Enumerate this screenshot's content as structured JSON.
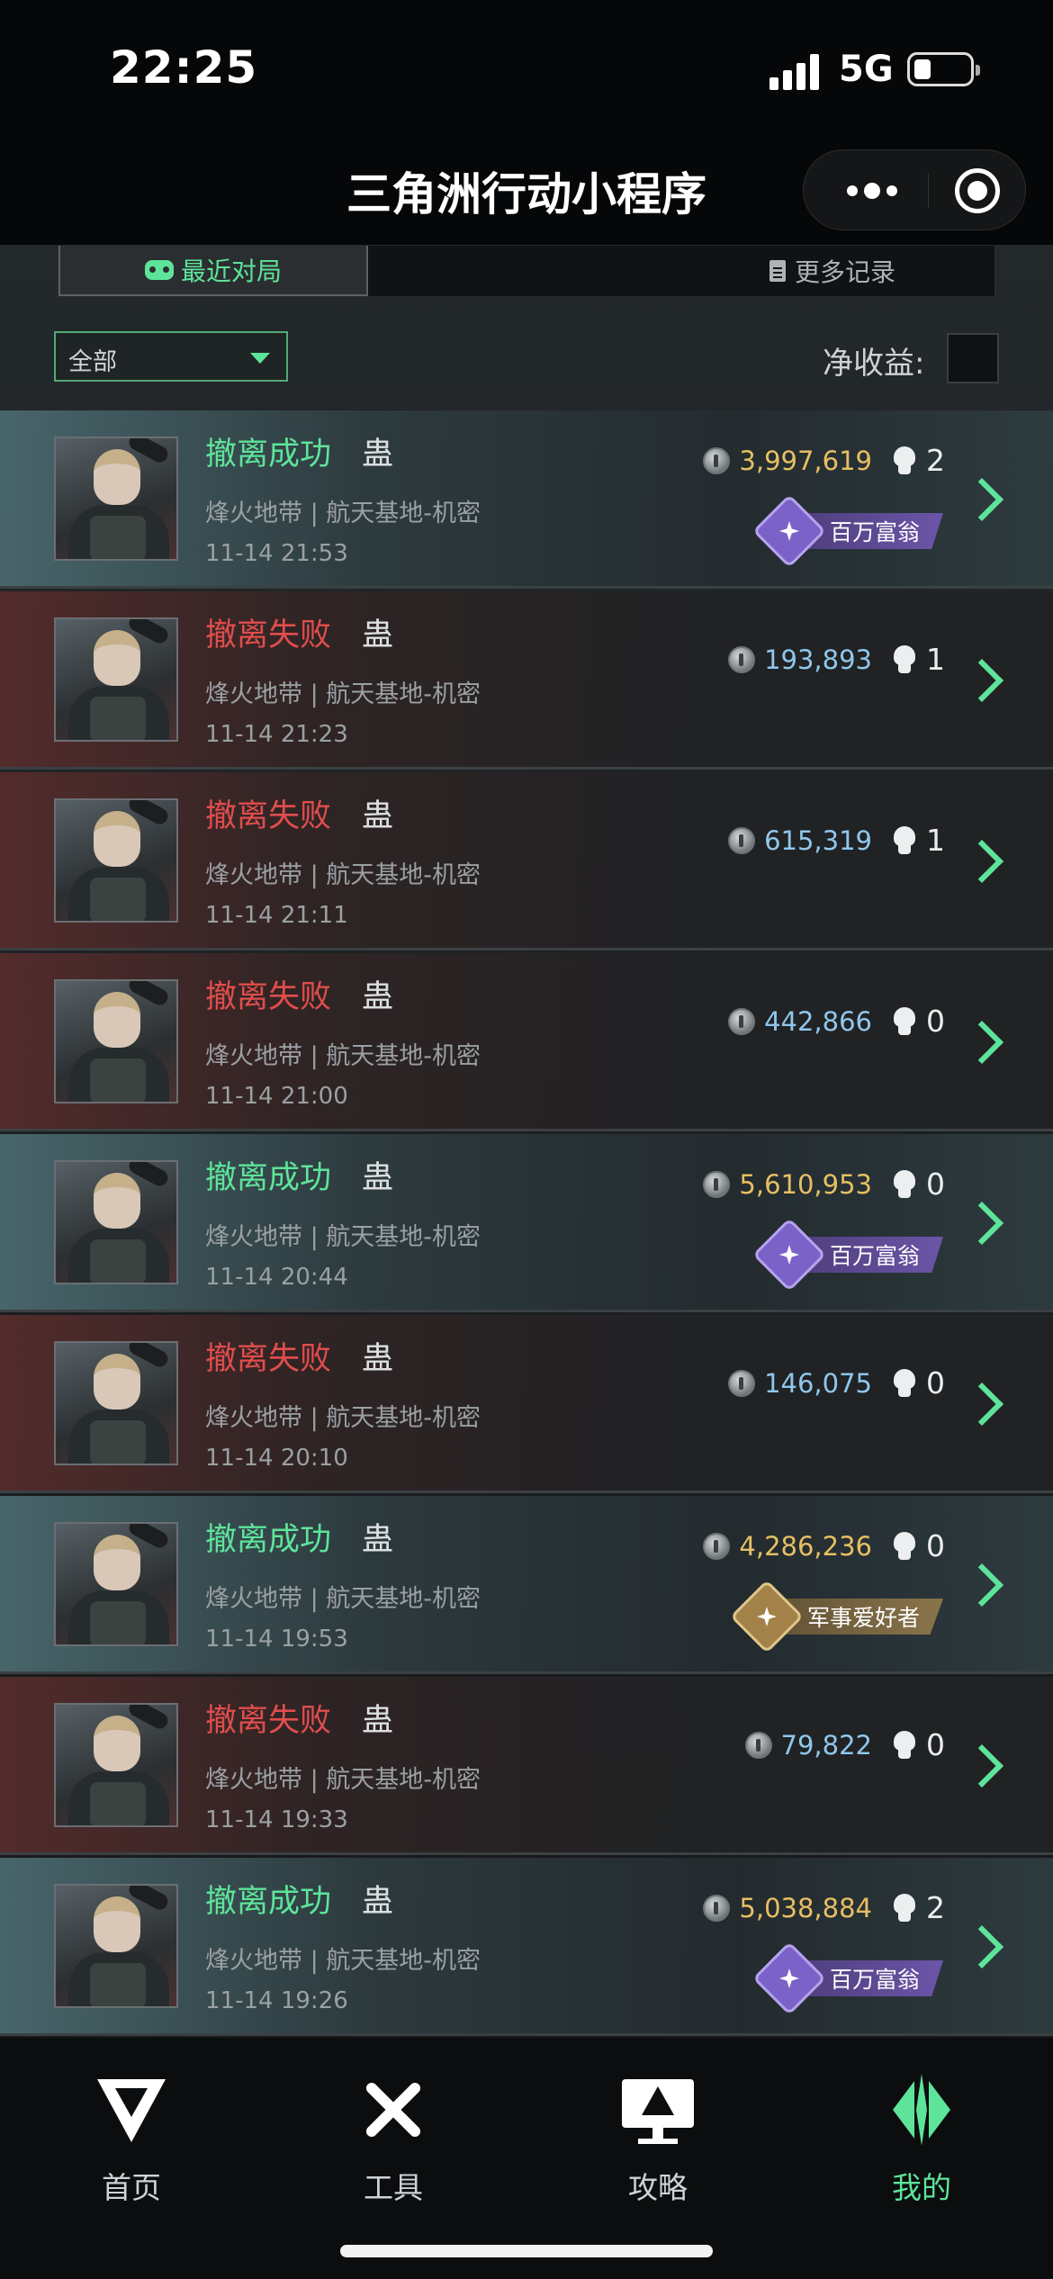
{
  "status_bar": {
    "time": "22:25",
    "network": "5G",
    "battery_level": 0.3
  },
  "title_bar": {
    "title": "三角洲行动小程序",
    "more_icon": "more-dots-icon",
    "close_icon": "close-target-icon"
  },
  "tabs": {
    "recent": "最近对局",
    "more_records": "更多记录"
  },
  "filter": {
    "selected": "全部",
    "net_income_label": "净收益:"
  },
  "colors": {
    "accent_green": "#5ee49a",
    "fail_red": "#e14d4d",
    "gold_value": "#e7bf63",
    "blue_value": "#8fc7ec"
  },
  "matches": [
    {
      "result": "撤离成功",
      "success": true,
      "player": "蛊",
      "mode": "烽火地带 | 航天基地-机密",
      "time": "11-14 21:53",
      "value": "3,997,619",
      "value_tone": "gold",
      "kills": "2",
      "badge": "百万富翁",
      "badge_tone": "purple"
    },
    {
      "result": "撤离失败",
      "success": false,
      "player": "蛊",
      "mode": "烽火地带 | 航天基地-机密",
      "time": "11-14 21:23",
      "value": "193,893",
      "value_tone": "blue",
      "kills": "1",
      "badge": null,
      "badge_tone": null
    },
    {
      "result": "撤离失败",
      "success": false,
      "player": "蛊",
      "mode": "烽火地带 | 航天基地-机密",
      "time": "11-14 21:11",
      "value": "615,319",
      "value_tone": "blue",
      "kills": "1",
      "badge": null,
      "badge_tone": null
    },
    {
      "result": "撤离失败",
      "success": false,
      "player": "蛊",
      "mode": "烽火地带 | 航天基地-机密",
      "time": "11-14 21:00",
      "value": "442,866",
      "value_tone": "blue",
      "kills": "0",
      "badge": null,
      "badge_tone": null
    },
    {
      "result": "撤离成功",
      "success": true,
      "player": "蛊",
      "mode": "烽火地带 | 航天基地-机密",
      "time": "11-14 20:44",
      "value": "5,610,953",
      "value_tone": "gold",
      "kills": "0",
      "badge": "百万富翁",
      "badge_tone": "purple"
    },
    {
      "result": "撤离失败",
      "success": false,
      "player": "蛊",
      "mode": "烽火地带 | 航天基地-机密",
      "time": "11-14 20:10",
      "value": "146,075",
      "value_tone": "blue",
      "kills": "0",
      "badge": null,
      "badge_tone": null
    },
    {
      "result": "撤离成功",
      "success": true,
      "player": "蛊",
      "mode": "烽火地带 | 航天基地-机密",
      "time": "11-14 19:53",
      "value": "4,286,236",
      "value_tone": "gold",
      "kills": "0",
      "badge": "军事爱好者",
      "badge_tone": "gold"
    },
    {
      "result": "撤离失败",
      "success": false,
      "player": "蛊",
      "mode": "烽火地带 | 航天基地-机密",
      "time": "11-14 19:33",
      "value": "79,822",
      "value_tone": "blue",
      "kills": "0",
      "badge": null,
      "badge_tone": null
    },
    {
      "result": "撤离成功",
      "success": true,
      "player": "蛊",
      "mode": "烽火地带 | 航天基地-机密",
      "time": "11-14 19:26",
      "value": "5,038,884",
      "value_tone": "gold",
      "kills": "2",
      "badge": "百万富翁",
      "badge_tone": "purple"
    }
  ],
  "bottom_nav": [
    {
      "label": "首页",
      "icon": "home-icon",
      "active": false
    },
    {
      "label": "工具",
      "icon": "tools-icon",
      "active": false
    },
    {
      "label": "攻略",
      "icon": "guide-icon",
      "active": false
    },
    {
      "label": "我的",
      "icon": "profile-icon",
      "active": true
    }
  ]
}
